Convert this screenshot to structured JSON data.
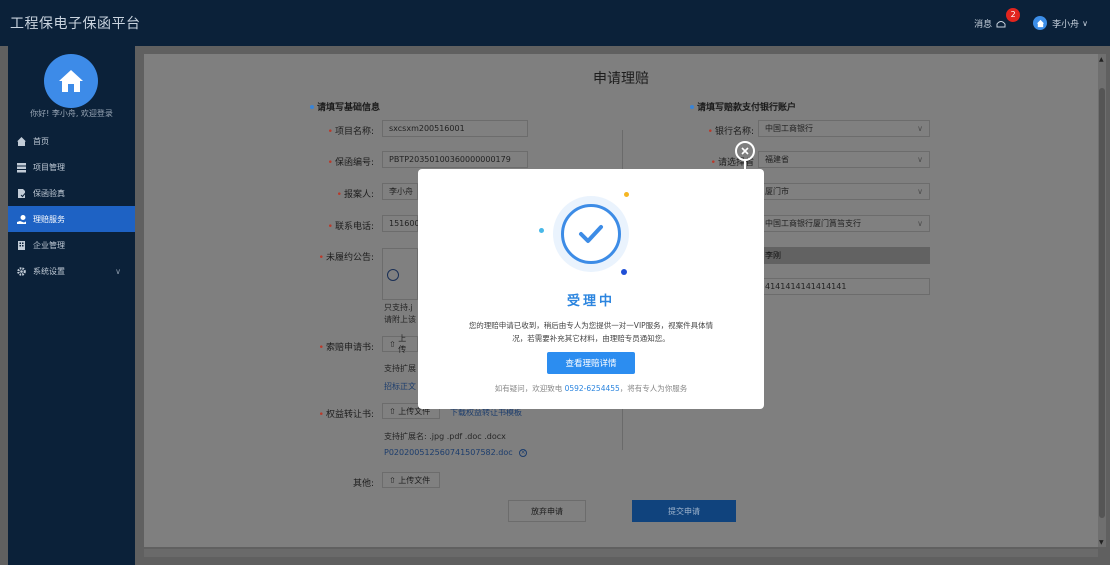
{
  "app": {
    "title": "工程保电子保函平台"
  },
  "topbar": {
    "message_label": "消息",
    "message_count": "2",
    "user_name": "李小舟",
    "user_caret": "∨"
  },
  "sidebar": {
    "welcome": "你好! 李小舟, 欢迎登录",
    "items": [
      {
        "label": "首页",
        "icon": "home-icon"
      },
      {
        "label": "项目管理",
        "icon": "grid-icon"
      },
      {
        "label": "保函验真",
        "icon": "document-icon"
      },
      {
        "label": "理赔服务",
        "icon": "hand-money-icon",
        "active": true
      },
      {
        "label": "企业管理",
        "icon": "building-icon"
      },
      {
        "label": "系统设置",
        "icon": "gear-icon",
        "chevron": "∨"
      }
    ]
  },
  "form": {
    "title": "申请理赔",
    "section_left": "请填写基础信息",
    "section_right": "请填写赔款支付银行账户",
    "project_name_label": "项目名称:",
    "project_name_value": "sxcsxm200516001",
    "guarantee_no_label": "保函编号:",
    "guarantee_no_value": "PBTP20350100360000000179",
    "reporter_label": "报案人:",
    "reporter_value": "李小舟",
    "phone_label": "联系电话:",
    "phone_value": "151600",
    "notice_label": "未履约公告:",
    "notice_hint1": "只支持.j",
    "notice_hint2": "请附上该",
    "claim_label": "索赔申请书:",
    "claim_upload": "上传",
    "claim_hint": "支持扩展",
    "claim_link": "招标正文",
    "rights_label": "权益转让书:",
    "rights_upload": "上传文件",
    "rights_template_link": "下载权益转让书模板",
    "rights_hint": "支持扩展名: .jpg .pdf .doc .docx",
    "rights_file": "P020200512560741507582.doc",
    "other_label": "其他:",
    "other_upload": "上传文件",
    "bank_name_label": "银行名称:",
    "bank_name_value": "中国工商银行",
    "province_label": "请选择省",
    "province_value": "福建省",
    "city_value": "厦门市",
    "branch_value": "中国工商银行厦门篔筜支行",
    "account_name_value": "李刚",
    "account_no_value": "4141414141414141",
    "cancel_button": "放弃申请",
    "submit_button": "提交申请"
  },
  "modal": {
    "title": "受理中",
    "desc_line1": "您的理赔申请已收到，稍后由专人为您提供一对一VIP服务，视案件具体情",
    "desc_line2": "况，若需要补充其它材料，由理赔专员通知您。",
    "button": "查看理赔详情",
    "foot_prefix": "如有疑问，欢迎致电",
    "foot_phone": "0592-6254455",
    "foot_suffix": "，将有专人为你服务"
  },
  "colors": {
    "accent": "#2c8df0",
    "sidebar_bg": "#0b2139",
    "active_nav": "#1e62c4",
    "badge": "#e2251e"
  }
}
